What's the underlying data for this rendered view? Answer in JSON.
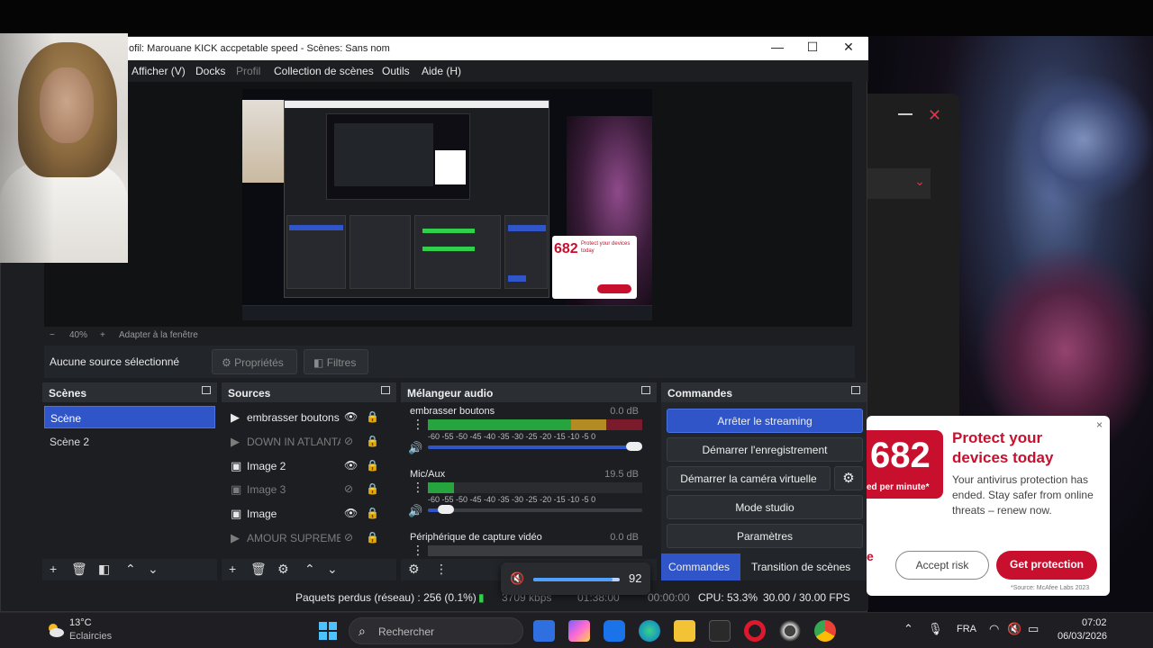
{
  "window": {
    "title": "ofil: Marouane KICK accpetable speed - Scènes: Sans nom",
    "minimize": "—",
    "maximize": "☐",
    "close": "✕"
  },
  "menu": {
    "items": [
      "Afficher (V)",
      "Docks",
      "Profil",
      "Collection de scènes",
      "Outils",
      "Aide (H)"
    ]
  },
  "preview": {
    "zoom_label": "40%",
    "minus": "−",
    "plus": "+",
    "fit_label": "Adapter à la fenêtre"
  },
  "context_bar": {
    "no_source": "Aucune source sélectionné",
    "properties": "Propriétés",
    "filters": "Filtres"
  },
  "scenes": {
    "title": "Scènes",
    "items": [
      "Scène",
      "Scène 2"
    ],
    "selected": "Scène"
  },
  "sources": {
    "title": "Sources",
    "items": [
      {
        "name": "embrasser boutons",
        "type": "media",
        "visible": true
      },
      {
        "name": "DOWN IN ATLANTA",
        "type": "media",
        "visible": false
      },
      {
        "name": "Image 2",
        "type": "image",
        "visible": true
      },
      {
        "name": "Image 3",
        "type": "image",
        "visible": false
      },
      {
        "name": "Image",
        "type": "image",
        "visible": true
      },
      {
        "name": "AMOUR SUPREME",
        "type": "media",
        "visible": false
      }
    ]
  },
  "mixer": {
    "title": "Mélangeur audio",
    "ticks": "-60 -55 -50 -45 -40 -35 -30 -25 -20 -15 -10 -5 0",
    "channels": [
      {
        "name": "embrasser boutons",
        "db": "0.0 dB",
        "level_pct": 100,
        "green_pct": 67,
        "yellow_pct": 16
      },
      {
        "name": "Mic/Aux",
        "db": "19.5 dB",
        "level_pct": 12,
        "green_pct": 67,
        "yellow_pct": 16
      },
      {
        "name": "Périphérique de capture vidéo",
        "db": "0.0 dB",
        "level_pct": 100,
        "green_pct": 67,
        "yellow_pct": 16
      }
    ]
  },
  "controls": {
    "title": "Commandes",
    "stop_streaming": "Arrêter le streaming",
    "start_recording": "Démarrer l'enregistrement",
    "start_virtual_cam": "Démarrer la caméra virtuelle",
    "studio_mode": "Mode studio",
    "settings": "Paramètres",
    "tab_commands": "Commandes",
    "tab_transitions": "Transition de scènes"
  },
  "status": {
    "dropped": "Paquets perdus (réseau) : 256 (0.1%)",
    "bitrate": "3709 kbps",
    "stream_time": "01:38:00",
    "rec_time": "00:00:00",
    "cpu": "CPU: 53.3%",
    "fps": "30.00 / 30.00 FPS"
  },
  "volume_popup": {
    "value": "92",
    "level_pct": 92
  },
  "mcafee": {
    "number": "682",
    "subtext": "ed per minute*",
    "heading": "Protect your devices today",
    "body": "Your antivirus protection has ended. Stay safer from online threats – renew now.",
    "accept": "Accept risk",
    "cta": "Get protection",
    "source": "*Source: McAfee Labs 2023",
    "letter": "e",
    "close": "×"
  },
  "taskbar": {
    "temp": "13°C",
    "weather": "Eclaircies",
    "search_placeholder": "Rechercher",
    "language": "FRA",
    "time": "07:02",
    "date": "06/03/2026"
  },
  "colors": {
    "accent": "#2f55c9",
    "mcafee_red": "#c8102e",
    "meter_green": "#26a53f"
  }
}
